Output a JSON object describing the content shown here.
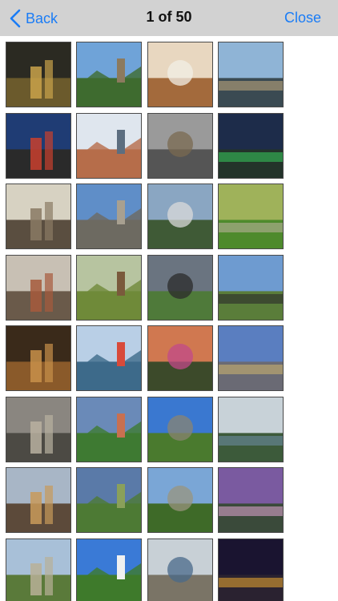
{
  "navbar": {
    "back_label": "Back",
    "title": "1 of 50",
    "close_label": "Close"
  },
  "colors": {
    "accent": "#1a7cf6",
    "navbar_bg": "#d2d2d2"
  },
  "thumbnails": [
    {
      "name": "canal-night",
      "sky": "#2b2a22",
      "land": "#6b5a2c",
      "accent": "#c9a24a"
    },
    {
      "name": "castle-trees",
      "sky": "#6fa3d8",
      "land": "#3e6b2f",
      "accent": "#8c7a5e"
    },
    {
      "name": "spiral-atrium",
      "sky": "#e8d7c0",
      "land": "#a36a3c",
      "accent": "#f2efe6"
    },
    {
      "name": "river-city",
      "sky": "#8fb4d6",
      "land": "#3a4a52",
      "accent": "#b9a37c"
    },
    {
      "name": "shopfront-street",
      "sky": "#1f3c74",
      "land": "#2a2a2a",
      "accent": "#c9402e"
    },
    {
      "name": "glass-arcade",
      "sky": "#dfe6ee",
      "land": "#b66d4a",
      "accent": "#5c6e80"
    },
    {
      "name": "sphere-sculpture",
      "sky": "#9a9a9a",
      "land": "#555555",
      "accent": "#7a6a50"
    },
    {
      "name": "bridge-night",
      "sky": "#1d2c4a",
      "land": "#23332a",
      "accent": "#36c25a"
    },
    {
      "name": "lane-street",
      "sky": "#d7d2c2",
      "land": "#5a4e40",
      "accent": "#8a7a64"
    },
    {
      "name": "cathedral",
      "sky": "#5f8ec8",
      "land": "#6d6a62",
      "accent": "#a8a090"
    },
    {
      "name": "mountain-village",
      "sky": "#8aa6c2",
      "land": "#3f5a36",
      "accent": "#d9d9d9"
    },
    {
      "name": "green-ruins",
      "sky": "#9fb25a",
      "land": "#4e8a2c",
      "accent": "#b8b09a"
    },
    {
      "name": "aerial-town",
      "sky": "#c8c0b4",
      "land": "#6a5a4a",
      "accent": "#a65a3c"
    },
    {
      "name": "hill-tower",
      "sky": "#b7c4a0",
      "land": "#6f8a3a",
      "accent": "#7a5a3c"
    },
    {
      "name": "sea-cliffs",
      "sky": "#6a7480",
      "land": "#4f7a3a",
      "accent": "#2b2b2b"
    },
    {
      "name": "windswept-tree",
      "sky": "#6e9bd0",
      "land": "#5a7d3a",
      "accent": "#2a2a2a"
    },
    {
      "name": "library-hall",
      "sky": "#3a2a1a",
      "land": "#8a5a2a",
      "accent": "#c8904a"
    },
    {
      "name": "harbour-houses",
      "sky": "#b9cfe6",
      "land": "#3d6a8a",
      "accent": "#d84a3a"
    },
    {
      "name": "sunset-flowers",
      "sky": "#d07850",
      "land": "#3c4a2a",
      "accent": "#c24a8a"
    },
    {
      "name": "spire-town",
      "sky": "#5a7ec0",
      "land": "#6a6a74",
      "accent": "#c8b070"
    },
    {
      "name": "aerial-street",
      "sky": "#8a8680",
      "land": "#4c4a44",
      "accent": "#b8b0a0"
    },
    {
      "name": "green-village",
      "sky": "#6a8ab8",
      "land": "#3e7a32",
      "accent": "#c87050"
    },
    {
      "name": "round-tower",
      "sky": "#3a78d0",
      "land": "#4a7a2e",
      "accent": "#8a8472"
    },
    {
      "name": "river-reflect",
      "sky": "#c8d2d8",
      "land": "#3c5a3a",
      "accent": "#6a8aa0"
    },
    {
      "name": "canal-houses",
      "sky": "#a8b6c6",
      "land": "#5c4a3a",
      "accent": "#c89a5a"
    },
    {
      "name": "winding-road",
      "sky": "#5a7aa8",
      "land": "#4e7a34",
      "accent": "#8aa05a"
    },
    {
      "name": "ruined-tower",
      "sky": "#7aa6d6",
      "land": "#3e6a28",
      "accent": "#9a947e"
    },
    {
      "name": "purple-sky-lake",
      "sky": "#7a5aa0",
      "land": "#3a4a3a",
      "accent": "#d6a0c8"
    },
    {
      "name": "grave-stones",
      "sky": "#a8c0d8",
      "land": "#5a7a3a",
      "accent": "#b8b098"
    },
    {
      "name": "cloud-field",
      "sky": "#3a7ad6",
      "land": "#3e7a2c",
      "accent": "#f0f0f0"
    },
    {
      "name": "coast-cove",
      "sky": "#c8d0d6",
      "land": "#7a7466",
      "accent": "#4a6a8a"
    },
    {
      "name": "night-street",
      "sky": "#1a1430",
      "land": "#2a2230",
      "accent": "#e0a030"
    }
  ]
}
